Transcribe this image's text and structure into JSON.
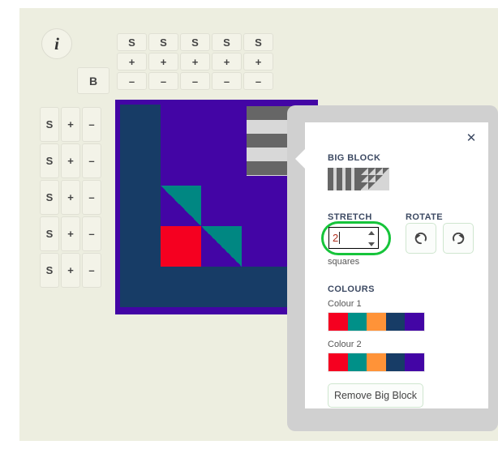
{
  "background_color": "#edeee0",
  "toolbar": {
    "info_label": "i",
    "block_label": "B",
    "column_controls": [
      {
        "select": "S",
        "add": "+",
        "remove": "–"
      },
      {
        "select": "S",
        "add": "+",
        "remove": "–"
      },
      {
        "select": "S",
        "add": "+",
        "remove": "–"
      },
      {
        "select": "S",
        "add": "+",
        "remove": "–"
      },
      {
        "select": "S",
        "add": "+",
        "remove": "–"
      }
    ],
    "row_controls": [
      {
        "select": "S",
        "add": "+",
        "remove": "–"
      },
      {
        "select": "S",
        "add": "+",
        "remove": "–"
      },
      {
        "select": "S",
        "add": "+",
        "remove": "–"
      },
      {
        "select": "S",
        "add": "+",
        "remove": "–"
      },
      {
        "select": "S",
        "add": "+",
        "remove": "–"
      }
    ]
  },
  "canvas": {
    "grid_rows": 5,
    "grid_cols": 5,
    "cell_size": 50,
    "base_color": "#4305a5",
    "navy": "#173c66",
    "teal": "#008782",
    "red": "#f50020",
    "selected_block": {
      "stripe_dark": "#666666",
      "stripe_light": "#d8d8d8",
      "col_start": 3,
      "col_span": 2,
      "row_start": 0,
      "row_span": 2
    },
    "cells": [
      {
        "row": 0,
        "col": 0,
        "color": "#173c66"
      },
      {
        "row": 1,
        "col": 0,
        "color": "#173c66"
      },
      {
        "row": 2,
        "col": 0,
        "color": "#173c66"
      },
      {
        "row": 3,
        "col": 0,
        "color": "#173c66"
      },
      {
        "row": 4,
        "col": 0,
        "color": "#173c66"
      },
      {
        "row": 4,
        "col": 1,
        "color": "#173c66"
      },
      {
        "row": 4,
        "col": 2,
        "color": "#173c66"
      },
      {
        "row": 4,
        "col": 3,
        "color": "#173c66"
      },
      {
        "row": 4,
        "col": 4,
        "color": "#173c66"
      },
      {
        "row": 3,
        "col": 1,
        "color": "#f50020"
      }
    ],
    "triangles": [
      {
        "row": 2,
        "col": 1,
        "color": "#008782",
        "dir": "ne"
      },
      {
        "row": 3,
        "col": 2,
        "color": "#008782",
        "dir": "ne"
      }
    ]
  },
  "panel": {
    "title": "BIG BLOCK",
    "close_label": "✕",
    "stretch_label": "STRETCH",
    "stretch_value": "2",
    "stretch_unit": "squares",
    "rotate_label": "ROTATE",
    "rotate_ccw_icon": "↺",
    "rotate_cw_icon": "↻",
    "colours_title": "COLOURS",
    "colour1_label": "Colour 1",
    "colour2_label": "Colour 2",
    "colour1_swatches": [
      "#f50020",
      "#009088",
      "#ff9338",
      "#173c66",
      "#4305a5"
    ],
    "colour2_swatches": [
      "#f50020",
      "#009088",
      "#ff9338",
      "#173c66",
      "#4305a5"
    ],
    "remove_label": "Remove Big Block",
    "highlight_color": "#16c43a"
  }
}
